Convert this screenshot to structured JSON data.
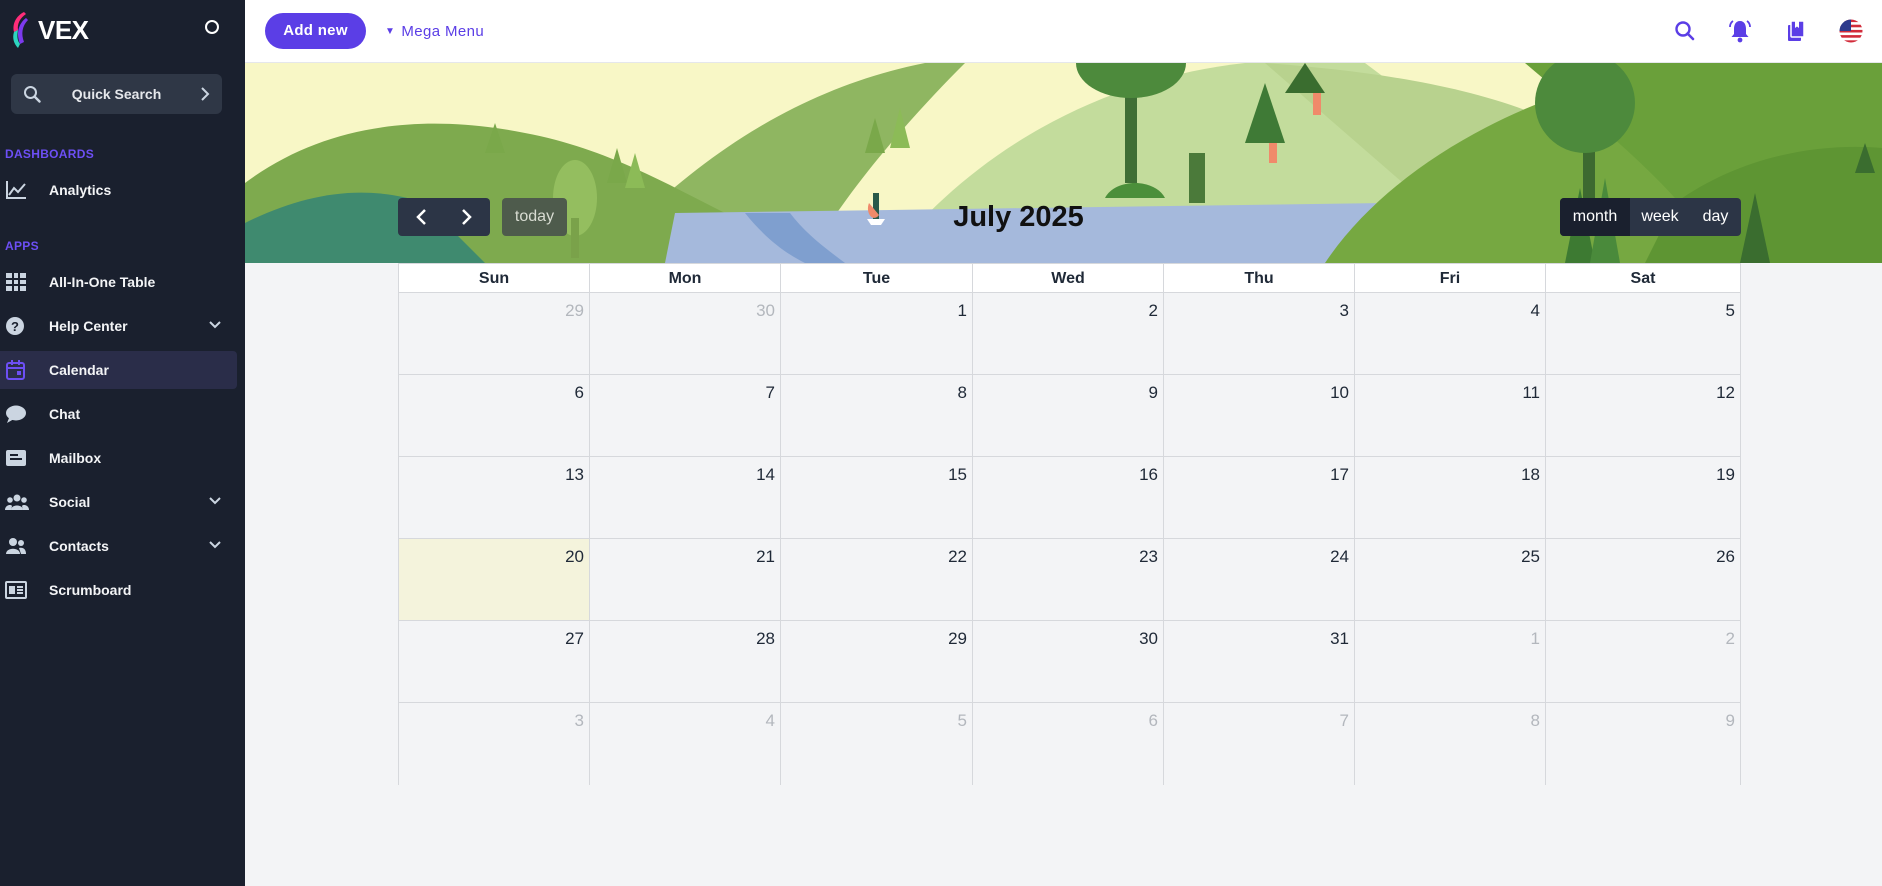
{
  "brand": {
    "name": "VEX"
  },
  "sidebar": {
    "quick_search": "Quick Search",
    "sections": {
      "dashboards": "DASHBOARDS",
      "apps": "APPS"
    },
    "items": [
      {
        "label": "Analytics"
      },
      {
        "label": "All-In-One Table"
      },
      {
        "label": "Help Center"
      },
      {
        "label": "Calendar"
      },
      {
        "label": "Chat"
      },
      {
        "label": "Mailbox"
      },
      {
        "label": "Social"
      },
      {
        "label": "Contacts"
      },
      {
        "label": "Scrumboard"
      }
    ]
  },
  "topbar": {
    "add_new": "Add new",
    "mega_menu": "Mega Menu",
    "icons": [
      "search-icon",
      "bell-icon",
      "bookmarks-icon",
      "us-flag-icon"
    ]
  },
  "calendar": {
    "title": "July 2025",
    "today_label": "today",
    "views": [
      "month",
      "week",
      "day"
    ],
    "active_view": "month",
    "days_of_week": [
      "Sun",
      "Mon",
      "Tue",
      "Wed",
      "Thu",
      "Fri",
      "Sat"
    ],
    "weeks": [
      [
        {
          "d": "29",
          "o": true
        },
        {
          "d": "30",
          "o": true
        },
        {
          "d": "1"
        },
        {
          "d": "2"
        },
        {
          "d": "3"
        },
        {
          "d": "4"
        },
        {
          "d": "5"
        }
      ],
      [
        {
          "d": "6"
        },
        {
          "d": "7"
        },
        {
          "d": "8"
        },
        {
          "d": "9"
        },
        {
          "d": "10"
        },
        {
          "d": "11"
        },
        {
          "d": "12"
        }
      ],
      [
        {
          "d": "13"
        },
        {
          "d": "14"
        },
        {
          "d": "15"
        },
        {
          "d": "16"
        },
        {
          "d": "17"
        },
        {
          "d": "18"
        },
        {
          "d": "19"
        }
      ],
      [
        {
          "d": "20",
          "t": true
        },
        {
          "d": "21"
        },
        {
          "d": "22"
        },
        {
          "d": "23"
        },
        {
          "d": "24"
        },
        {
          "d": "25"
        },
        {
          "d": "26"
        }
      ],
      [
        {
          "d": "27"
        },
        {
          "d": "28"
        },
        {
          "d": "29"
        },
        {
          "d": "30"
        },
        {
          "d": "31"
        },
        {
          "d": "1",
          "o": true
        },
        {
          "d": "2",
          "o": true
        }
      ],
      [
        {
          "d": "3",
          "o": true
        },
        {
          "d": "4",
          "o": true
        },
        {
          "d": "5",
          "o": true
        },
        {
          "d": "6",
          "o": true
        },
        {
          "d": "7",
          "o": true
        },
        {
          "d": "8",
          "o": true
        },
        {
          "d": "9",
          "o": true
        }
      ]
    ]
  },
  "colors": {
    "accent": "#5b3ee6",
    "sidebar_bg": "#1a202e",
    "today_bg": "#f4f3dc"
  }
}
